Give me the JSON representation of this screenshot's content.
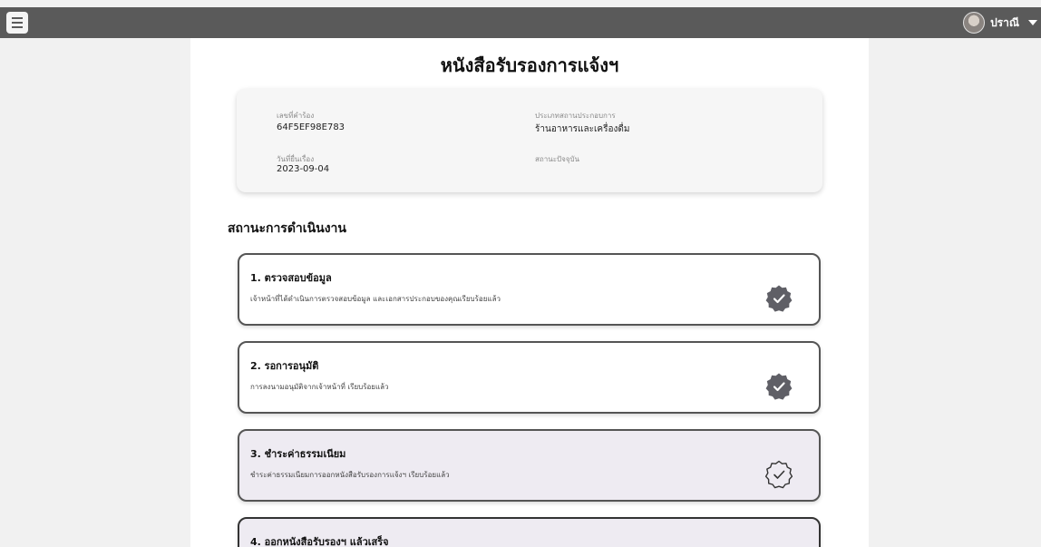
{
  "header": {
    "user_name": "ปราณี"
  },
  "page": {
    "title": "หนังสือรับรองการแจ้งฯ"
  },
  "info": {
    "request_no_label": "เลขที่คำร้อง",
    "request_no": "64F5EF98E783",
    "business_type_label": "ประเภทสถานประกอบการ",
    "business_type": "ร้านอาหารและเครื่องดื่ม",
    "submit_date_label": "วันที่ยื่นเรื่อง",
    "submit_date": "2023-09-04",
    "current_status_label": "สถานะปัจจุบัน",
    "current_status": ""
  },
  "section": {
    "title": "สถานะการดำเนินงาน"
  },
  "steps": [
    {
      "title": "1. ตรวจสอบข้อมูล",
      "description": "เจ้าหน้าที่ได้ดำเนินการตรวจสอบข้อมูล และเอกสารประกอบของคุณเรียบร้อยแล้ว",
      "status": "done"
    },
    {
      "title": "2. รอการอนุมัติ",
      "description": "การลงนามอนุมัติจากเจ้าหน้าที่ เรียบร้อยแล้ว",
      "status": "done"
    },
    {
      "title": "3. ชำระค่าธรรมเนียม",
      "description": "ชำระค่าธรรมเนียมการออกหนังสือรับรองการแจ้งฯ เรียบร้อยแล้ว",
      "status": "current"
    },
    {
      "title": "4. ออกหนังสือรับรองฯ แล้วเสร็จ",
      "description": "",
      "status": "pending"
    }
  ],
  "colors": {
    "topbar": "#5a5a5a",
    "badge_done": "#5f5f66",
    "step_active_bg": "#eeebf2",
    "step_border": "#555555"
  }
}
